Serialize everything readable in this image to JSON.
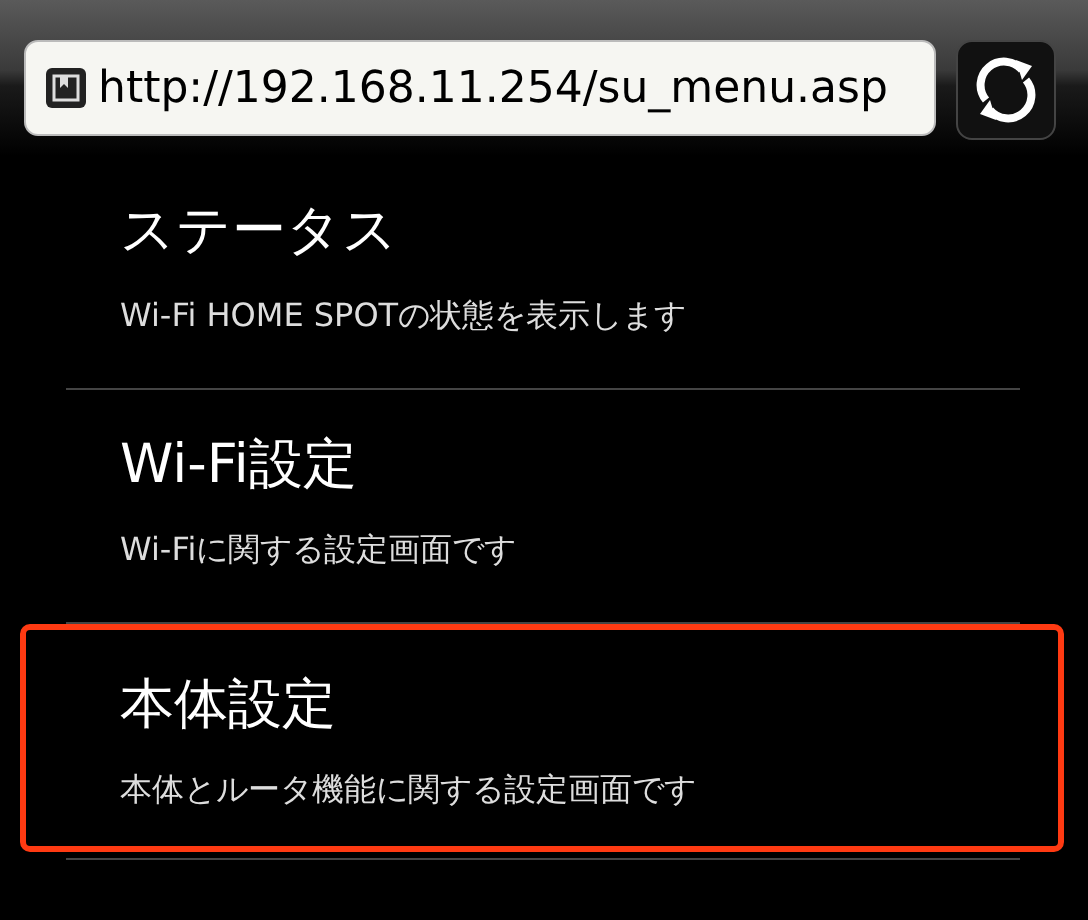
{
  "address_bar": {
    "url": "http://192.168.11.254/su_menu.asp"
  },
  "menu": [
    {
      "title": "ステータス",
      "description": "Wi-Fi HOME SPOTの状態を表示します",
      "highlighted": false
    },
    {
      "title": "Wi-Fi設定",
      "description": "Wi-Fiに関する設定画面です",
      "highlighted": false
    },
    {
      "title": "本体設定",
      "description": "本体とルータ機能に関する設定画面です",
      "highlighted": true
    }
  ]
}
